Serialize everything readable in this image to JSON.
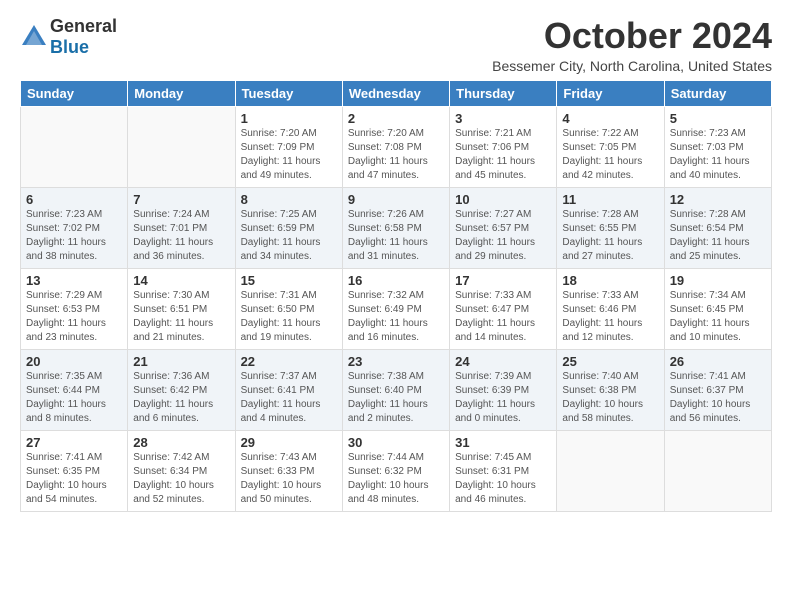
{
  "logo": {
    "general": "General",
    "blue": "Blue"
  },
  "header": {
    "month": "October 2024",
    "location": "Bessemer City, North Carolina, United States"
  },
  "days_of_week": [
    "Sunday",
    "Monday",
    "Tuesday",
    "Wednesday",
    "Thursday",
    "Friday",
    "Saturday"
  ],
  "weeks": [
    [
      {
        "day": "",
        "info": ""
      },
      {
        "day": "",
        "info": ""
      },
      {
        "day": "1",
        "info": "Sunrise: 7:20 AM\nSunset: 7:09 PM\nDaylight: 11 hours and 49 minutes."
      },
      {
        "day": "2",
        "info": "Sunrise: 7:20 AM\nSunset: 7:08 PM\nDaylight: 11 hours and 47 minutes."
      },
      {
        "day": "3",
        "info": "Sunrise: 7:21 AM\nSunset: 7:06 PM\nDaylight: 11 hours and 45 minutes."
      },
      {
        "day": "4",
        "info": "Sunrise: 7:22 AM\nSunset: 7:05 PM\nDaylight: 11 hours and 42 minutes."
      },
      {
        "day": "5",
        "info": "Sunrise: 7:23 AM\nSunset: 7:03 PM\nDaylight: 11 hours and 40 minutes."
      }
    ],
    [
      {
        "day": "6",
        "info": "Sunrise: 7:23 AM\nSunset: 7:02 PM\nDaylight: 11 hours and 38 minutes."
      },
      {
        "day": "7",
        "info": "Sunrise: 7:24 AM\nSunset: 7:01 PM\nDaylight: 11 hours and 36 minutes."
      },
      {
        "day": "8",
        "info": "Sunrise: 7:25 AM\nSunset: 6:59 PM\nDaylight: 11 hours and 34 minutes."
      },
      {
        "day": "9",
        "info": "Sunrise: 7:26 AM\nSunset: 6:58 PM\nDaylight: 11 hours and 31 minutes."
      },
      {
        "day": "10",
        "info": "Sunrise: 7:27 AM\nSunset: 6:57 PM\nDaylight: 11 hours and 29 minutes."
      },
      {
        "day": "11",
        "info": "Sunrise: 7:28 AM\nSunset: 6:55 PM\nDaylight: 11 hours and 27 minutes."
      },
      {
        "day": "12",
        "info": "Sunrise: 7:28 AM\nSunset: 6:54 PM\nDaylight: 11 hours and 25 minutes."
      }
    ],
    [
      {
        "day": "13",
        "info": "Sunrise: 7:29 AM\nSunset: 6:53 PM\nDaylight: 11 hours and 23 minutes."
      },
      {
        "day": "14",
        "info": "Sunrise: 7:30 AM\nSunset: 6:51 PM\nDaylight: 11 hours and 21 minutes."
      },
      {
        "day": "15",
        "info": "Sunrise: 7:31 AM\nSunset: 6:50 PM\nDaylight: 11 hours and 19 minutes."
      },
      {
        "day": "16",
        "info": "Sunrise: 7:32 AM\nSunset: 6:49 PM\nDaylight: 11 hours and 16 minutes."
      },
      {
        "day": "17",
        "info": "Sunrise: 7:33 AM\nSunset: 6:47 PM\nDaylight: 11 hours and 14 minutes."
      },
      {
        "day": "18",
        "info": "Sunrise: 7:33 AM\nSunset: 6:46 PM\nDaylight: 11 hours and 12 minutes."
      },
      {
        "day": "19",
        "info": "Sunrise: 7:34 AM\nSunset: 6:45 PM\nDaylight: 11 hours and 10 minutes."
      }
    ],
    [
      {
        "day": "20",
        "info": "Sunrise: 7:35 AM\nSunset: 6:44 PM\nDaylight: 11 hours and 8 minutes."
      },
      {
        "day": "21",
        "info": "Sunrise: 7:36 AM\nSunset: 6:42 PM\nDaylight: 11 hours and 6 minutes."
      },
      {
        "day": "22",
        "info": "Sunrise: 7:37 AM\nSunset: 6:41 PM\nDaylight: 11 hours and 4 minutes."
      },
      {
        "day": "23",
        "info": "Sunrise: 7:38 AM\nSunset: 6:40 PM\nDaylight: 11 hours and 2 minutes."
      },
      {
        "day": "24",
        "info": "Sunrise: 7:39 AM\nSunset: 6:39 PM\nDaylight: 11 hours and 0 minutes."
      },
      {
        "day": "25",
        "info": "Sunrise: 7:40 AM\nSunset: 6:38 PM\nDaylight: 10 hours and 58 minutes."
      },
      {
        "day": "26",
        "info": "Sunrise: 7:41 AM\nSunset: 6:37 PM\nDaylight: 10 hours and 56 minutes."
      }
    ],
    [
      {
        "day": "27",
        "info": "Sunrise: 7:41 AM\nSunset: 6:35 PM\nDaylight: 10 hours and 54 minutes."
      },
      {
        "day": "28",
        "info": "Sunrise: 7:42 AM\nSunset: 6:34 PM\nDaylight: 10 hours and 52 minutes."
      },
      {
        "day": "29",
        "info": "Sunrise: 7:43 AM\nSunset: 6:33 PM\nDaylight: 10 hours and 50 minutes."
      },
      {
        "day": "30",
        "info": "Sunrise: 7:44 AM\nSunset: 6:32 PM\nDaylight: 10 hours and 48 minutes."
      },
      {
        "day": "31",
        "info": "Sunrise: 7:45 AM\nSunset: 6:31 PM\nDaylight: 10 hours and 46 minutes."
      },
      {
        "day": "",
        "info": ""
      },
      {
        "day": "",
        "info": ""
      }
    ]
  ]
}
